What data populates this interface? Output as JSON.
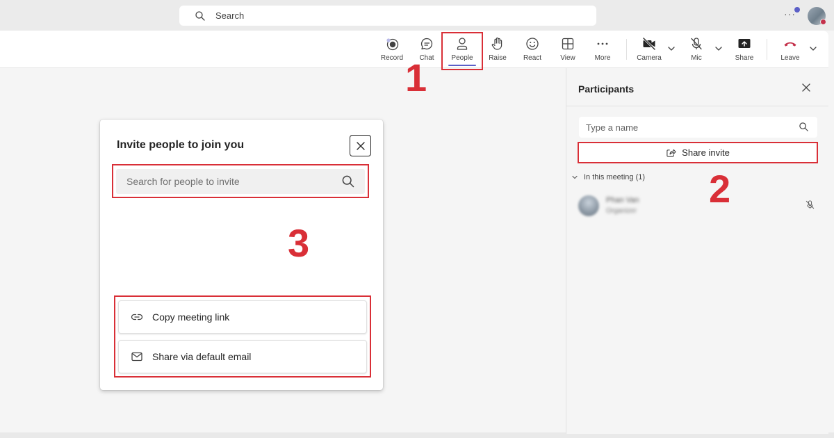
{
  "topbar": {
    "search_placeholder": "Search",
    "more_label": "···"
  },
  "toolbar": {
    "buttons": [
      {
        "key": "record",
        "label": "Record"
      },
      {
        "key": "chat",
        "label": "Chat"
      },
      {
        "key": "people",
        "label": "People",
        "active": true
      },
      {
        "key": "raise",
        "label": "Raise"
      },
      {
        "key": "react",
        "label": "React"
      },
      {
        "key": "view",
        "label": "View"
      },
      {
        "key": "more",
        "label": "More"
      },
      {
        "key": "camera",
        "label": "Camera"
      },
      {
        "key": "mic",
        "label": "Mic"
      },
      {
        "key": "share",
        "label": "Share"
      },
      {
        "key": "leave",
        "label": "Leave"
      }
    ],
    "accent_color": "#5b5fc7",
    "leave_color": "#c4314b"
  },
  "participants_panel": {
    "title": "Participants",
    "search_placeholder": "Type a name",
    "share_invite_label": "Share invite",
    "section_label": "In this meeting (1)",
    "participant": {
      "name": "Phan Van",
      "role": "Organizer",
      "muted": true
    }
  },
  "invite_dialog": {
    "title": "Invite people to join you",
    "search_placeholder": "Search for people to invite",
    "actions": [
      {
        "label": "Copy meeting link",
        "icon": "link-icon"
      },
      {
        "label": "Share via default email",
        "icon": "mail-icon"
      }
    ]
  },
  "annotations": {
    "step_1": "1",
    "step_2": "2",
    "step_3": "3",
    "highlight_color": "#d92f37"
  }
}
